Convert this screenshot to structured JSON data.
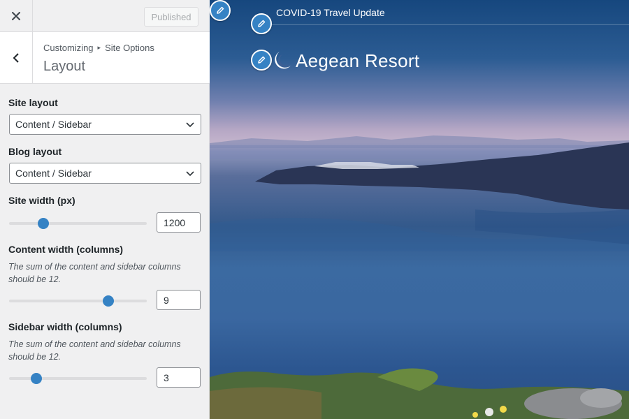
{
  "topbar": {
    "close_icon": "close-icon",
    "publish_label": "Published"
  },
  "section": {
    "back_icon": "chevron-left-icon",
    "breadcrumb_root": "Customizing",
    "breadcrumb_separator": "▸",
    "breadcrumb_parent": "Site Options",
    "title": "Layout"
  },
  "controls": {
    "site_layout": {
      "label": "Site layout",
      "value": "Content / Sidebar"
    },
    "blog_layout": {
      "label": "Blog layout",
      "value": "Content / Sidebar"
    },
    "site_width": {
      "label": "Site width (px)",
      "value": "1200",
      "slider_fraction": 0.25
    },
    "content_width": {
      "label": "Content width (columns)",
      "description": "The sum of the content and sidebar columns should be 12.",
      "value": "9",
      "slider_fraction": 0.72
    },
    "sidebar_width": {
      "label": "Sidebar width (columns)",
      "description": "The sum of the content and sidebar columns should be 12.",
      "value": "3",
      "slider_fraction": 0.2
    }
  },
  "preview": {
    "announcement": "COVID-19 Travel Update",
    "site_name": "Aegean Resort",
    "edit_icon": "pencil-icon",
    "logo_icon": "crescent-moon-icon"
  },
  "colors": {
    "accent": "#3582c4",
    "sidebar_bg": "#f0f0f1"
  }
}
